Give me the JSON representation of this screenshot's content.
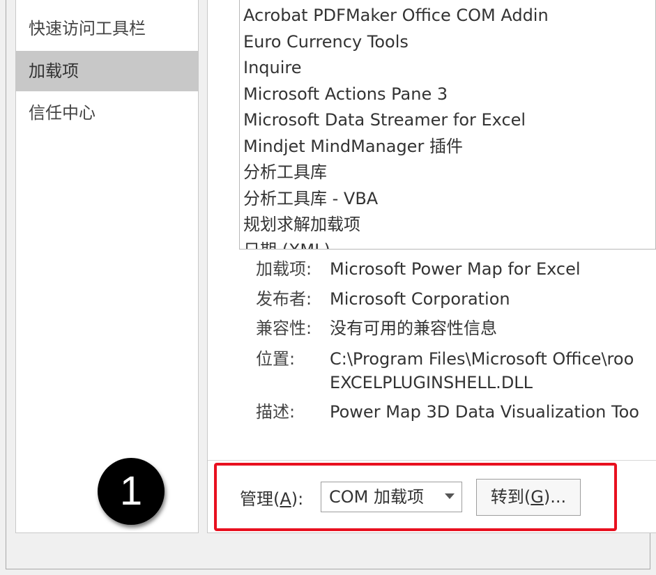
{
  "nav": {
    "items": [
      {
        "label": "快速访问工具栏"
      },
      {
        "label": "加载项",
        "selected": true
      },
      {
        "label": "信任中心"
      }
    ]
  },
  "addins_list": [
    "Acrobat PDFMaker Office COM Addin",
    "Euro Currency Tools",
    "Inquire",
    "Microsoft Actions Pane 3",
    "Microsoft Data Streamer for Excel",
    "Mindjet MindManager 插件",
    "分析工具库",
    "分析工具库 - VBA",
    "规划求解加载项",
    "日期 (XML)"
  ],
  "details": {
    "addin_label": "加载项:",
    "addin_value": "Microsoft Power Map for Excel",
    "publisher_label": "发布者:",
    "publisher_value": "Microsoft Corporation",
    "compat_label": "兼容性:",
    "compat_value": "没有可用的兼容性信息",
    "location_label": "位置:",
    "location_value_1": "C:\\Program Files\\Microsoft Office\\roo",
    "location_value_2": "EXCELPLUGINSHELL.DLL",
    "desc_label": "描述:",
    "desc_value": "Power Map 3D Data Visualization Too"
  },
  "manage": {
    "label_prefix": "管理(",
    "label_key": "A",
    "label_suffix": "):",
    "selected": "COM 加载项",
    "go_prefix": "转到(",
    "go_key": "G",
    "go_suffix": ")..."
  },
  "annotation": {
    "step_number": "1",
    "highlight_color": "#e8101f"
  }
}
